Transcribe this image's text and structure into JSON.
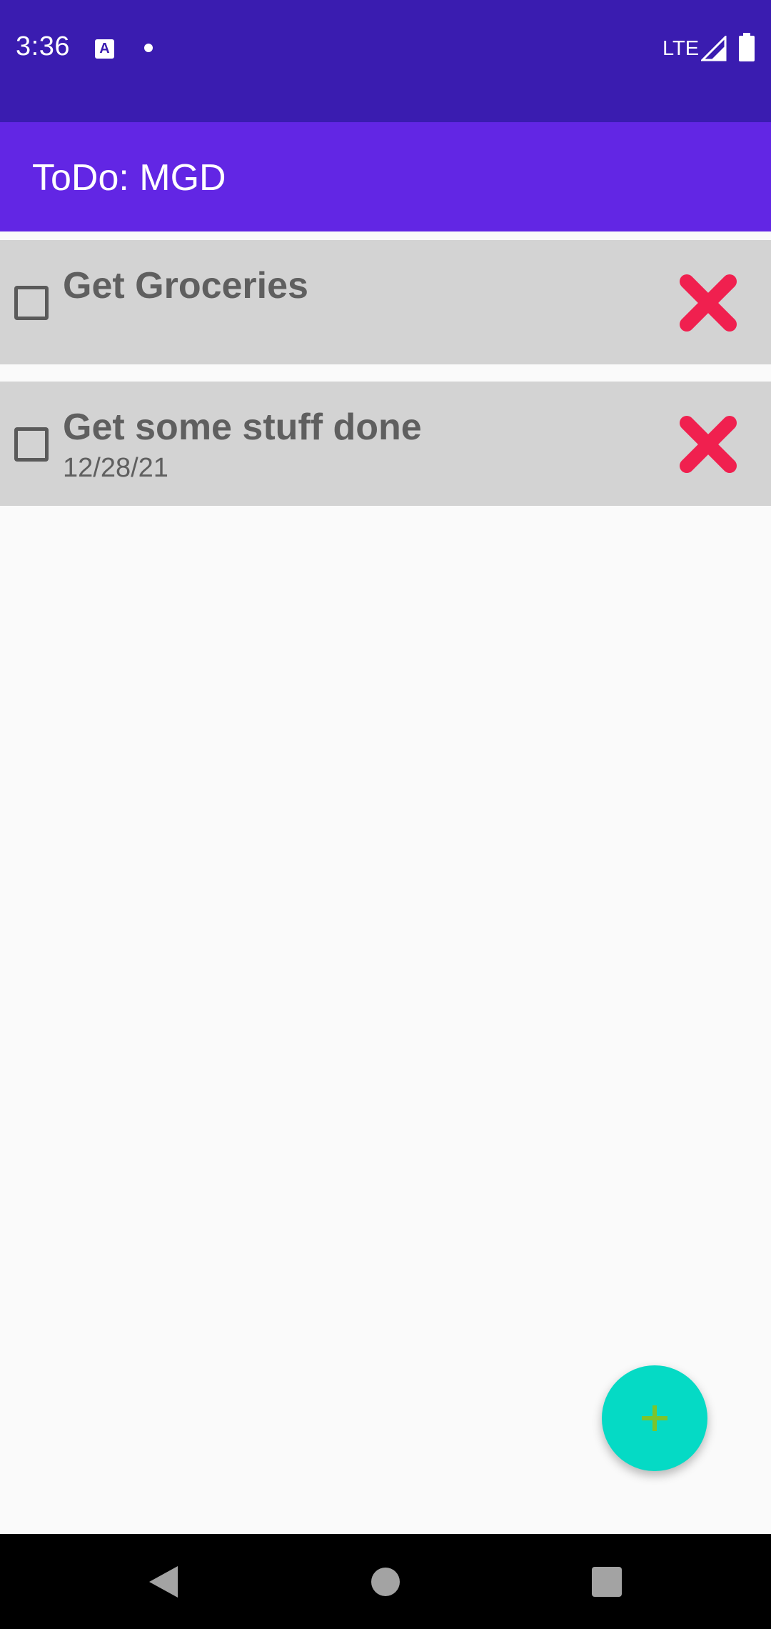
{
  "status_bar": {
    "time": "3:36",
    "network": "LTE",
    "icons": [
      "keyboard-a-icon",
      "notification-dot-icon",
      "signal-icon",
      "battery-icon"
    ]
  },
  "app_bar": {
    "title": "ToDo: MGD",
    "color": "#6226e4"
  },
  "todos": [
    {
      "title": "Get Groceries",
      "date": "",
      "checked": false
    },
    {
      "title": "Get some stuff done",
      "date": "12/28/21",
      "checked": false
    }
  ],
  "fab": {
    "icon": "plus-icon",
    "color": "#05dac5"
  },
  "colors": {
    "status_bar": "#3a1cb0",
    "item_bg": "#d3d3d3",
    "delete": "#f0204f"
  }
}
